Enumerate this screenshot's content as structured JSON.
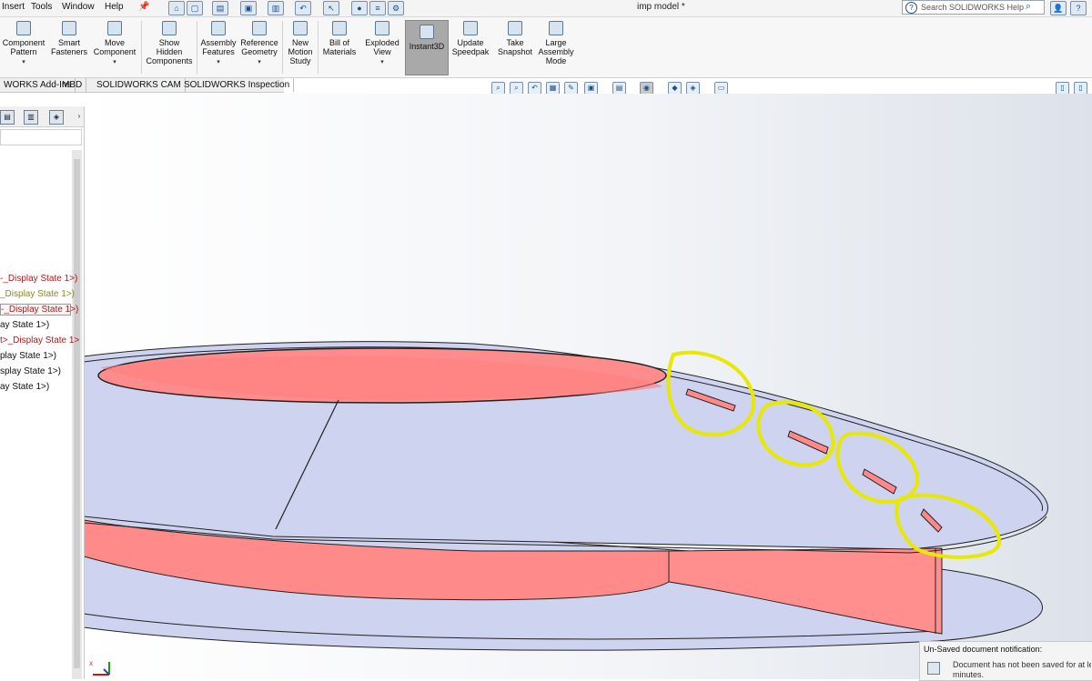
{
  "menu": [
    "Insert",
    "Tools",
    "Window",
    "Help"
  ],
  "window_title": "imp model *",
  "search": {
    "placeholder": "Search SOLIDWORKS Help"
  },
  "ribbon": {
    "buttons": [
      {
        "label": "Component\nPattern"
      },
      {
        "label": "Smart\nFasteners"
      },
      {
        "label": "Move\nComponent"
      },
      {
        "label": "Show\nHidden\nComponents"
      },
      {
        "label": "Assembly\nFeatures"
      },
      {
        "label": "Reference\nGeometry"
      },
      {
        "label": "New\nMotion\nStudy"
      },
      {
        "label": "Bill of\nMaterials"
      },
      {
        "label": "Exploded\nView"
      },
      {
        "label": "Instant3D"
      },
      {
        "label": "Update\nSpeedpak"
      },
      {
        "label": "Take\nSnapshot"
      },
      {
        "label": "Large\nAssembly\nMode"
      }
    ]
  },
  "tabs": [
    "WORKS Add-Ins",
    "MBD",
    "SOLIDWORKS CAM",
    "SOLIDWORKS Inspection"
  ],
  "tree": {
    "rows": [
      {
        "text": "-_Display State 1>)",
        "style": "red"
      },
      {
        "text": "_Display State 1>)",
        "style": "olive"
      },
      {
        "text": "-_Display State 1>)",
        "style": "red"
      },
      {
        "text": "ay State 1>)",
        "style": "black"
      },
      {
        "text": "t>_Display State 1>",
        "style": "red"
      },
      {
        "text": "play State 1>)",
        "style": "black"
      },
      {
        "text": "splay State 1>)",
        "style": "black"
      },
      {
        "text": "ay State 1>)",
        "style": "black"
      }
    ]
  },
  "notification": {
    "title": "Un-Saved document notification:",
    "message": "Document has not been saved for at le",
    "message2": "minutes."
  },
  "colors": {
    "model_face": "#ced3ef",
    "cut_face": "#ff8888",
    "highlight": "#e8e800"
  }
}
